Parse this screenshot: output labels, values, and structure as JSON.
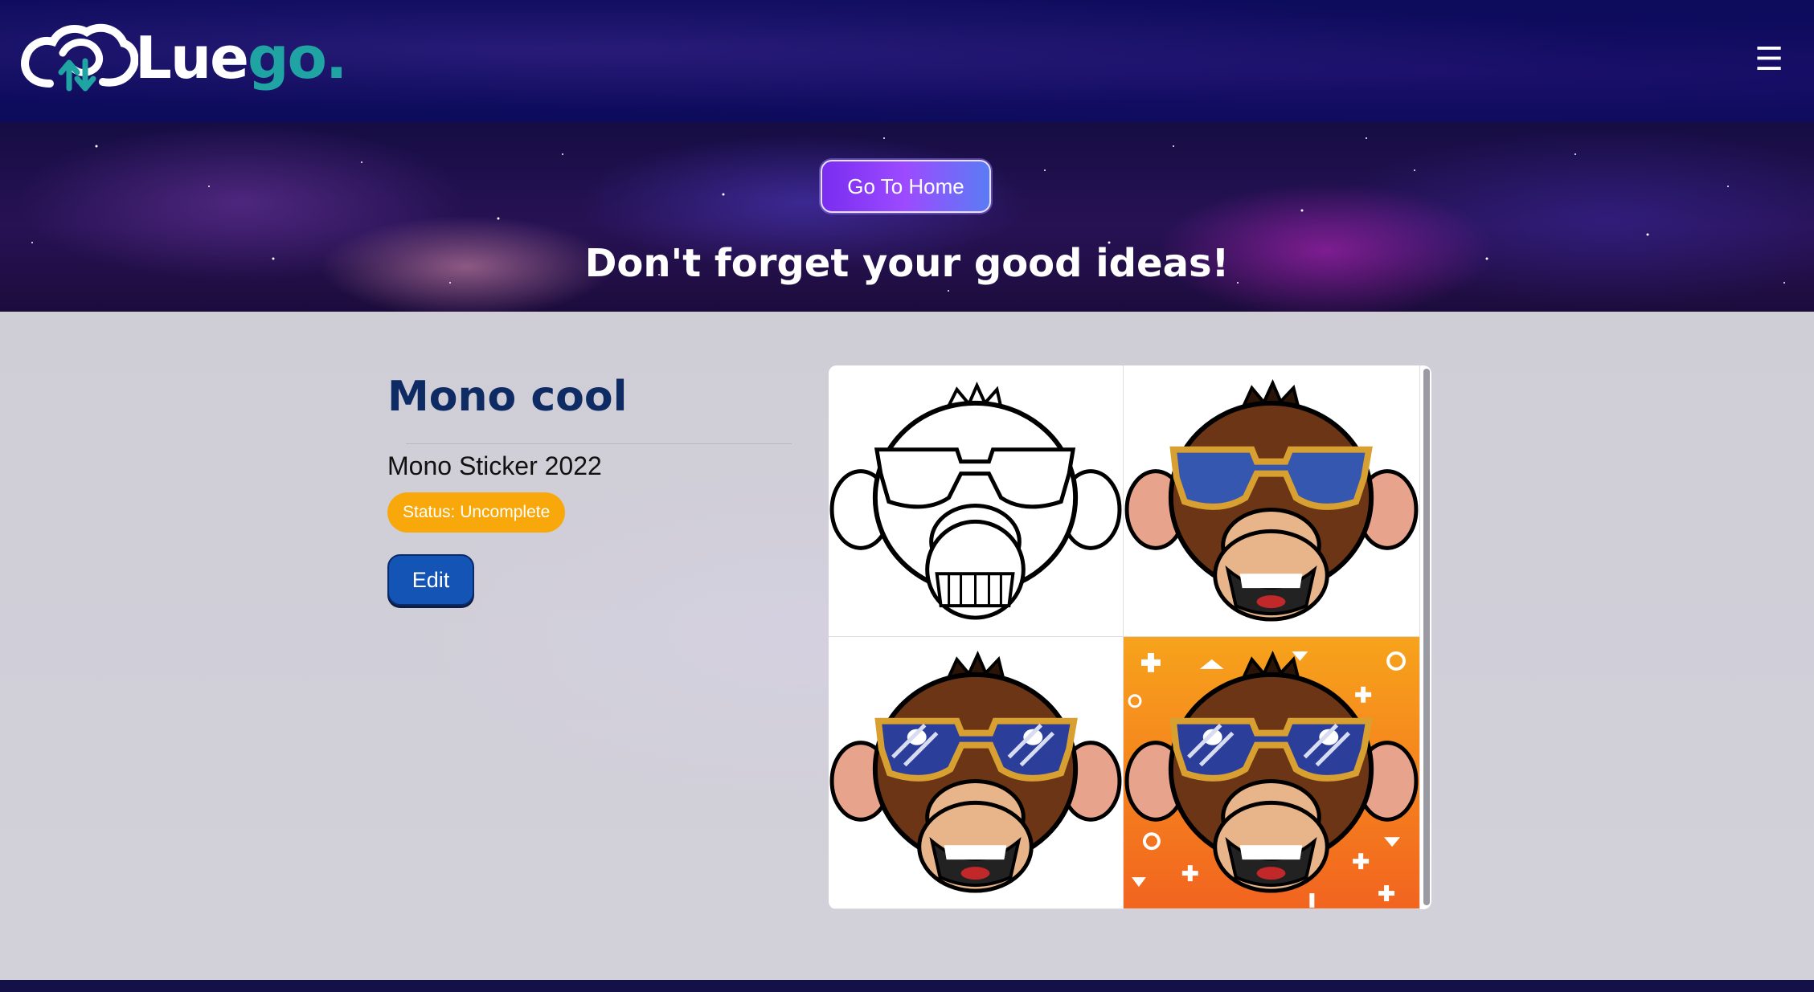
{
  "navbar": {
    "brand": {
      "text_main": "Lue",
      "text_accent": "go",
      "text_dot": "."
    },
    "menu_icon": "hamburger-menu-icon"
  },
  "hero": {
    "home_button_label": "Go To Home",
    "tagline": "Don't forget your good ideas!"
  },
  "idea": {
    "title": "Mono cool",
    "subtitle": "Mono Sticker 2022",
    "status_label": "Status: Uncomplete",
    "edit_label": "Edit"
  },
  "gallery": {
    "images": [
      {
        "variant": "line-art"
      },
      {
        "variant": "colored-flat-glasses"
      },
      {
        "variant": "colored-shiny-glasses"
      },
      {
        "variant": "colored-orange-background"
      }
    ]
  },
  "colors": {
    "navbar": "#0d0b5c",
    "title": "#0f2b63",
    "status": "#f8a80a",
    "edit_button": "#1454b4",
    "brand_accent": "#1fa3a3"
  }
}
